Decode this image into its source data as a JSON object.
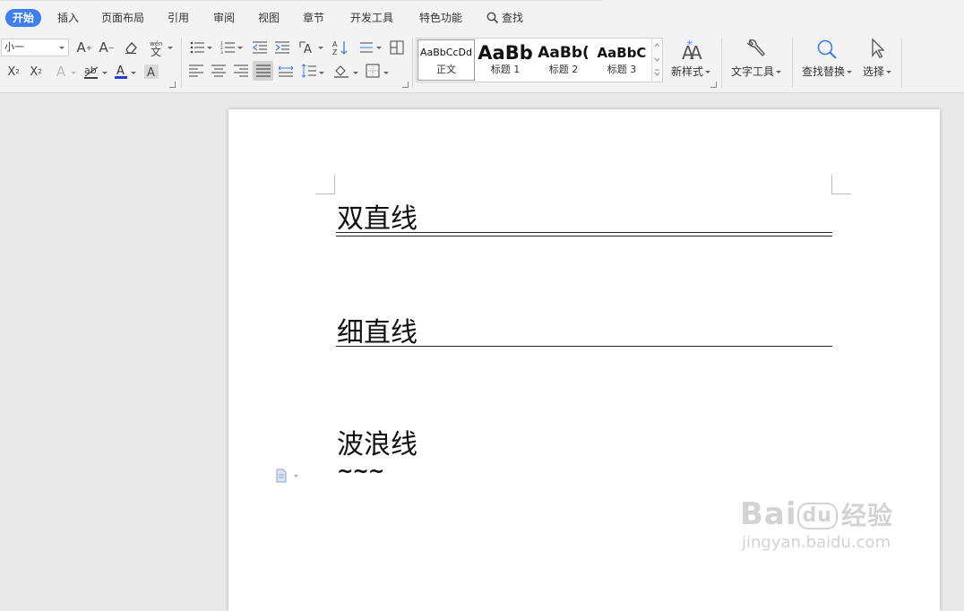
{
  "menu": {
    "tabs": [
      "开始",
      "插入",
      "页面布局",
      "引用",
      "审阅",
      "视图",
      "章节",
      "开发工具",
      "特色功能"
    ],
    "find_label": "查找"
  },
  "ribbon": {
    "font_size": "小一",
    "styles": [
      {
        "sample": "AaBbCcDd",
        "name": "正文"
      },
      {
        "sample": "AaBb",
        "name": "标题 1"
      },
      {
        "sample": "AaBb(",
        "name": "标题 2"
      },
      {
        "sample": "AaBbC",
        "name": "标题 3"
      }
    ],
    "new_style_label": "新样式",
    "text_tools_label": "文字工具",
    "find_replace_label": "查找替换",
    "select_label": "选择"
  },
  "document": {
    "heading_1": "双直线",
    "heading_2": "细直线",
    "heading_3": "波浪线",
    "wavy_text": "~~~"
  },
  "watermark": {
    "main": "Bai",
    "paw": "du",
    "cn": "经验",
    "sub": "jingyan.baidu.com"
  },
  "colors": {
    "accent": "#3d7ef0",
    "font_color_underline": "#1f3fd8",
    "toolbar_bg": "#f3f3f3",
    "workspace_bg": "#e9e9e9"
  }
}
